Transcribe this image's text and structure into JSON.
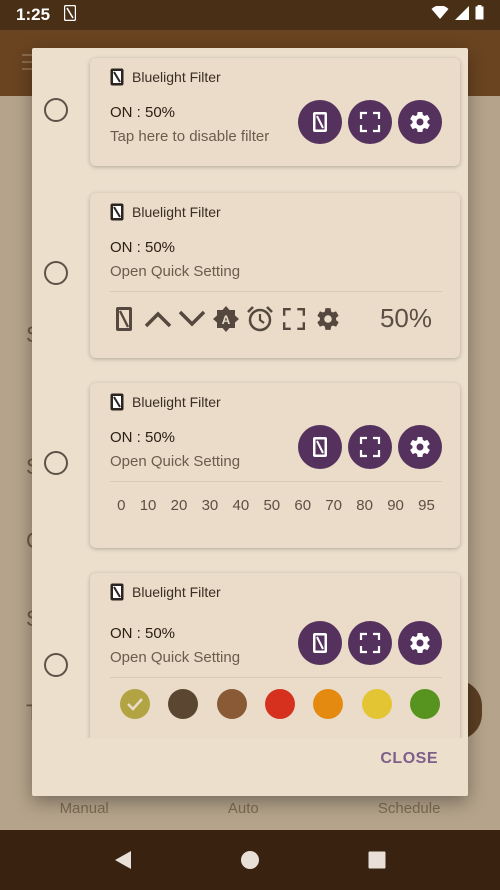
{
  "status_bar": {
    "time": "1:25"
  },
  "background_app": {
    "letters": [
      "S",
      "S",
      "C",
      "S",
      "T"
    ],
    "tabs": [
      "Manual",
      "Auto",
      "Schedule"
    ]
  },
  "dialog": {
    "options": [
      {
        "app_name": "Bluelight Filter",
        "status": "ON : 50%",
        "action": "Tap here to disable filter"
      },
      {
        "app_name": "Bluelight Filter",
        "status": "ON : 50%",
        "action": "Open Quick Setting",
        "percent": "50%"
      },
      {
        "app_name": "Bluelight Filter",
        "status": "ON : 50%",
        "action": "Open Quick Setting",
        "levels": [
          "0",
          "10",
          "20",
          "30",
          "40",
          "50",
          "60",
          "70",
          "80",
          "90",
          "95"
        ]
      },
      {
        "app_name": "Bluelight Filter",
        "status": "ON : 50%",
        "action": "Open Quick Setting",
        "colors": [
          "#b2a443",
          "#5b4631",
          "#8a5a36",
          "#d6311f",
          "#e48a10",
          "#e3c534",
          "#56931f"
        ],
        "selected_color_index": 0
      }
    ],
    "close_label": "CLOSE"
  },
  "theme": {
    "accent": "#55325e",
    "close_text": "#7d5f8a"
  }
}
